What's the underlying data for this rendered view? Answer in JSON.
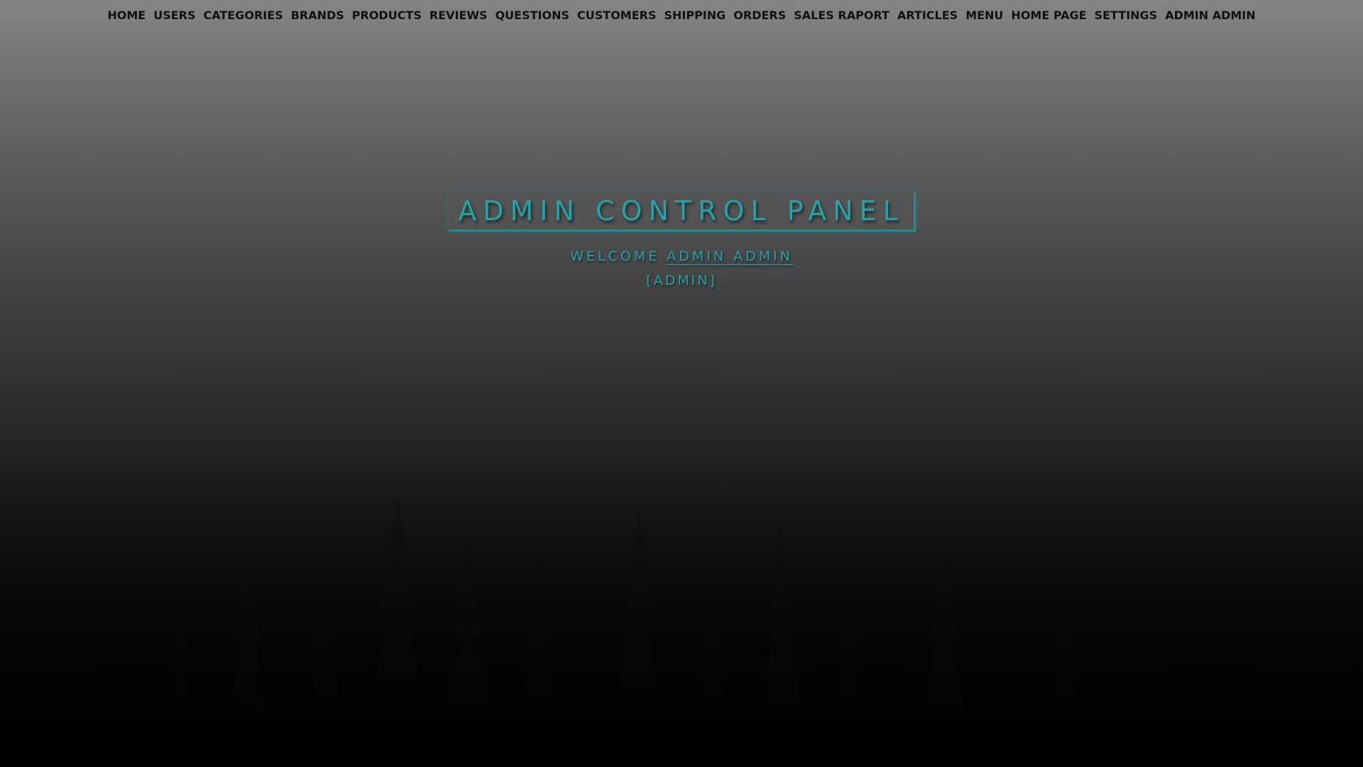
{
  "nav": {
    "items": [
      {
        "label": "HOME"
      },
      {
        "label": "USERS"
      },
      {
        "label": "CATEGORIES"
      },
      {
        "label": "BRANDS"
      },
      {
        "label": "PRODUCTS"
      },
      {
        "label": "REVIEWS"
      },
      {
        "label": "QUESTIONS"
      },
      {
        "label": "CUSTOMERS"
      },
      {
        "label": "SHIPPING"
      },
      {
        "label": "ORDERS"
      },
      {
        "label": "SALES RAPORT"
      },
      {
        "label": "ARTICLES"
      },
      {
        "label": "MENU"
      },
      {
        "label": "HOME PAGE"
      },
      {
        "label": "SETTINGS"
      },
      {
        "label": "ADMIN ADMIN"
      }
    ]
  },
  "main": {
    "title": "ADMIN CONTROL PANEL",
    "welcome_prefix": "WELCOME",
    "welcome_user": "ADMIN ADMIN",
    "role": "[ADMIN]"
  },
  "colors": {
    "accent": "#23a3a7",
    "nav_text": "#111111"
  }
}
